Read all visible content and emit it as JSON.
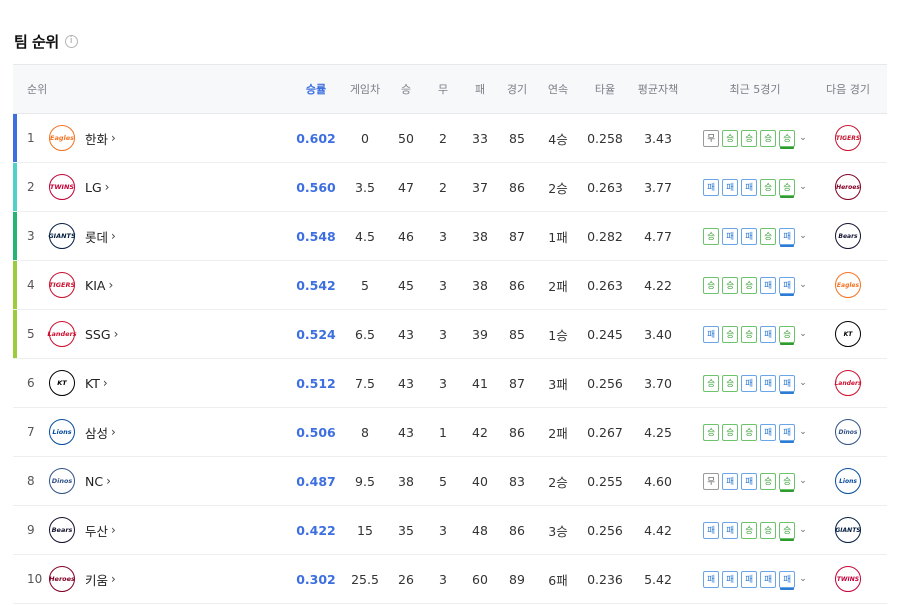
{
  "title": "팀 순위",
  "info_icon": "info-icon",
  "headers": {
    "rank": "순위",
    "pct": "승률",
    "gb": "게임차",
    "w": "승",
    "d": "무",
    "l": "패",
    "g": "경기",
    "streak": "연속",
    "avg": "타율",
    "era": "평균자책",
    "last5": "최근 5경기",
    "next": "다음 경기"
  },
  "rank_bar_colors": [
    "#3d6fe0",
    "#4fd1c5",
    "#22b573",
    "#9ccc3c",
    "#9ccc3c",
    "",
    "",
    "",
    "",
    ""
  ],
  "rows": [
    {
      "rank": "1",
      "team": "한화",
      "logo": "Eagles",
      "logo_color": "#f37321",
      "pct": "0.602",
      "gb": "0",
      "w": "50",
      "d": "2",
      "l": "33",
      "g": "85",
      "streak": "4승",
      "avg": "0.258",
      "era": "3.43",
      "last5": [
        "무",
        "승",
        "승",
        "승",
        "승"
      ],
      "next": "TIGERS",
      "next_color": "#c8102e"
    },
    {
      "rank": "2",
      "team": "LG",
      "logo": "TWINS",
      "logo_color": "#c30037",
      "pct": "0.560",
      "gb": "3.5",
      "w": "47",
      "d": "2",
      "l": "37",
      "g": "86",
      "streak": "2승",
      "avg": "0.263",
      "era": "3.77",
      "last5": [
        "패",
        "패",
        "패",
        "승",
        "승"
      ],
      "next": "Heroes",
      "next_color": "#820024"
    },
    {
      "rank": "3",
      "team": "롯데",
      "logo": "GIANTS",
      "logo_color": "#041e42",
      "pct": "0.548",
      "gb": "4.5",
      "w": "46",
      "d": "3",
      "l": "38",
      "g": "87",
      "streak": "1패",
      "avg": "0.282",
      "era": "4.77",
      "last5": [
        "승",
        "패",
        "패",
        "승",
        "패"
      ],
      "next": "Bears",
      "next_color": "#131230"
    },
    {
      "rank": "4",
      "team": "KIA",
      "logo": "TIGERS",
      "logo_color": "#c8102e",
      "pct": "0.542",
      "gb": "5",
      "w": "45",
      "d": "3",
      "l": "38",
      "g": "86",
      "streak": "2패",
      "avg": "0.263",
      "era": "4.22",
      "last5": [
        "승",
        "승",
        "승",
        "패",
        "패"
      ],
      "next": "Eagles",
      "next_color": "#f37321"
    },
    {
      "rank": "5",
      "team": "SSG",
      "logo": "Landers",
      "logo_color": "#ce0e2d",
      "pct": "0.524",
      "gb": "6.5",
      "w": "43",
      "d": "3",
      "l": "39",
      "g": "85",
      "streak": "1승",
      "avg": "0.245",
      "era": "3.40",
      "last5": [
        "패",
        "승",
        "승",
        "패",
        "승"
      ],
      "next": "KT",
      "next_color": "#000000"
    },
    {
      "rank": "6",
      "team": "KT",
      "logo": "KT",
      "logo_color": "#000000",
      "pct": "0.512",
      "gb": "7.5",
      "w": "43",
      "d": "3",
      "l": "41",
      "g": "87",
      "streak": "3패",
      "avg": "0.256",
      "era": "3.70",
      "last5": [
        "승",
        "승",
        "패",
        "패",
        "패"
      ],
      "next": "Landers",
      "next_color": "#ce0e2d"
    },
    {
      "rank": "7",
      "team": "삼성",
      "logo": "Lions",
      "logo_color": "#074ca1",
      "pct": "0.506",
      "gb": "8",
      "w": "43",
      "d": "1",
      "l": "42",
      "g": "86",
      "streak": "2패",
      "avg": "0.267",
      "era": "4.25",
      "last5": [
        "승",
        "승",
        "승",
        "패",
        "패"
      ],
      "next": "Dinos",
      "next_color": "#315288"
    },
    {
      "rank": "8",
      "team": "NC",
      "logo": "Dinos",
      "logo_color": "#315288",
      "pct": "0.487",
      "gb": "9.5",
      "w": "38",
      "d": "5",
      "l": "40",
      "g": "83",
      "streak": "2승",
      "avg": "0.255",
      "era": "4.60",
      "last5": [
        "무",
        "패",
        "패",
        "승",
        "승"
      ],
      "next": "Lions",
      "next_color": "#074ca1"
    },
    {
      "rank": "9",
      "team": "두산",
      "logo": "Bears",
      "logo_color": "#131230",
      "pct": "0.422",
      "gb": "15",
      "w": "35",
      "d": "3",
      "l": "48",
      "g": "86",
      "streak": "3승",
      "avg": "0.256",
      "era": "4.42",
      "last5": [
        "패",
        "패",
        "승",
        "승",
        "승"
      ],
      "next": "GIANTS",
      "next_color": "#041e42"
    },
    {
      "rank": "10",
      "team": "키움",
      "logo": "Heroes",
      "logo_color": "#820024",
      "pct": "0.302",
      "gb": "25.5",
      "w": "26",
      "d": "3",
      "l": "60",
      "g": "89",
      "streak": "6패",
      "avg": "0.236",
      "era": "5.42",
      "last5": [
        "패",
        "패",
        "패",
        "패",
        "패"
      ],
      "next": "TWINS",
      "next_color": "#c30037"
    }
  ]
}
